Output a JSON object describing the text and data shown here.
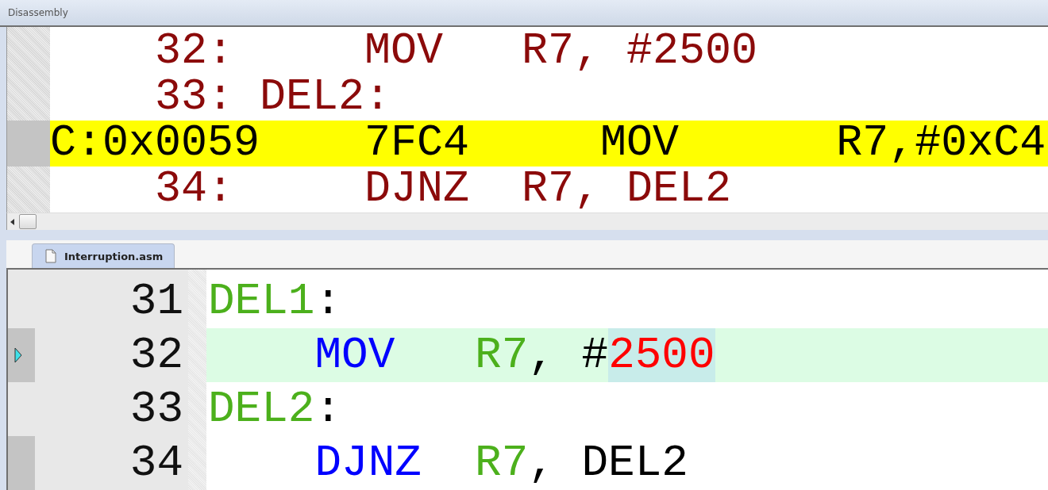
{
  "disassembly": {
    "title": "Disassembly",
    "rows": [
      {
        "kind": "source",
        "number": "32:",
        "mnemonic": "MOV",
        "operands": "R7, #2500"
      },
      {
        "kind": "source",
        "number": "33:",
        "label": "DEL2:"
      },
      {
        "kind": "asm",
        "selected": true,
        "address": "C:0x0059",
        "opcode": "7FC4",
        "mnemonic": "MOV",
        "operands": "R7,#0xC4"
      },
      {
        "kind": "source",
        "number": "34:",
        "mnemonic": "DJNZ",
        "operands": "R7, DEL2"
      }
    ]
  },
  "editor": {
    "tabs": [
      {
        "label": "Interruption.asm",
        "selected": true
      }
    ],
    "lines": [
      {
        "number": "31",
        "kind": "label",
        "current": false,
        "marked": false,
        "tokens": [
          {
            "text": "DEL1",
            "kind": "label"
          },
          {
            "text": ":",
            "kind": "plain"
          }
        ]
      },
      {
        "number": "32",
        "kind": "instruction",
        "current": true,
        "marked": true,
        "tokens": [
          {
            "text": "MOV",
            "kind": "keyword"
          },
          {
            "text": "R7",
            "kind": "register"
          },
          {
            "text": ",",
            "kind": "plain"
          },
          {
            "text": "#",
            "kind": "plain"
          },
          {
            "text": "2500",
            "kind": "number",
            "selected": true
          }
        ]
      },
      {
        "number": "33",
        "kind": "label",
        "current": false,
        "marked": false,
        "tokens": [
          {
            "text": "DEL2",
            "kind": "label"
          },
          {
            "text": ":",
            "kind": "plain"
          }
        ]
      },
      {
        "number": "34",
        "kind": "instruction",
        "current": false,
        "marked": true,
        "tokens": [
          {
            "text": "DJNZ",
            "kind": "keyword"
          },
          {
            "text": "R7",
            "kind": "register"
          },
          {
            "text": ",",
            "kind": "plain"
          },
          {
            "text": "DEL2",
            "kind": "plain"
          }
        ]
      }
    ]
  }
}
